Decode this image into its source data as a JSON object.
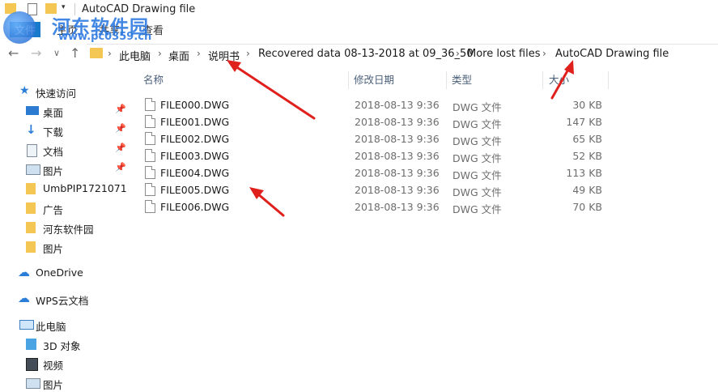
{
  "window": {
    "title": "AutoCAD Drawing file"
  },
  "ribbon": {
    "tabs": [
      "文件",
      "主页",
      "共享",
      "查看"
    ]
  },
  "watermark": {
    "title": "河东软件园",
    "url": "www.pc0359.cn"
  },
  "breadcrumb": [
    "此电脑",
    "桌面",
    "说明书",
    "Recovered data 08-13-2018 at 09_36_50",
    "More lost files",
    "AutoCAD Drawing file"
  ],
  "columns": {
    "name": "名称",
    "date": "修改日期",
    "type": "类型",
    "size": "大小"
  },
  "files": [
    {
      "name": "FILE000.DWG",
      "date": "2018-08-13 9:36",
      "type": "DWG 文件",
      "size": "30 KB"
    },
    {
      "name": "FILE001.DWG",
      "date": "2018-08-13 9:36",
      "type": "DWG 文件",
      "size": "147 KB"
    },
    {
      "name": "FILE002.DWG",
      "date": "2018-08-13 9:36",
      "type": "DWG 文件",
      "size": "65 KB"
    },
    {
      "name": "FILE003.DWG",
      "date": "2018-08-13 9:36",
      "type": "DWG 文件",
      "size": "52 KB"
    },
    {
      "name": "FILE004.DWG",
      "date": "2018-08-13 9:36",
      "type": "DWG 文件",
      "size": "113 KB"
    },
    {
      "name": "FILE005.DWG",
      "date": "2018-08-13 9:36",
      "type": "DWG 文件",
      "size": "49 KB"
    },
    {
      "name": "FILE006.DWG",
      "date": "2018-08-13 9:36",
      "type": "DWG 文件",
      "size": "70 KB"
    }
  ],
  "sidebar": {
    "quick_access": "快速访问",
    "items": [
      {
        "label": "桌面",
        "icon": "desktop-icon",
        "pinned": true
      },
      {
        "label": "下载",
        "icon": "download-icon",
        "pinned": true
      },
      {
        "label": "文档",
        "icon": "document-icon",
        "pinned": true
      },
      {
        "label": "图片",
        "icon": "picture-icon",
        "pinned": true
      },
      {
        "label": "UmbPIP1721071",
        "icon": "folder-icon",
        "pinned": false
      },
      {
        "label": "广告",
        "icon": "folder-icon",
        "pinned": false
      },
      {
        "label": "河东软件园",
        "icon": "folder-icon",
        "pinned": false
      },
      {
        "label": "图片",
        "icon": "folder-icon",
        "pinned": false
      }
    ],
    "onedrive": "OneDrive",
    "wps": "WPS云文档",
    "this_pc": "此电脑",
    "pc_items": [
      {
        "label": "3D 对象",
        "icon": "3d-objects-icon"
      },
      {
        "label": "视频",
        "icon": "video-icon"
      },
      {
        "label": "图片",
        "icon": "picture-icon"
      }
    ]
  },
  "colors": {
    "accent": "#2e7be0",
    "folder": "#f4c653",
    "annotation_arrow": "#e0201c"
  }
}
